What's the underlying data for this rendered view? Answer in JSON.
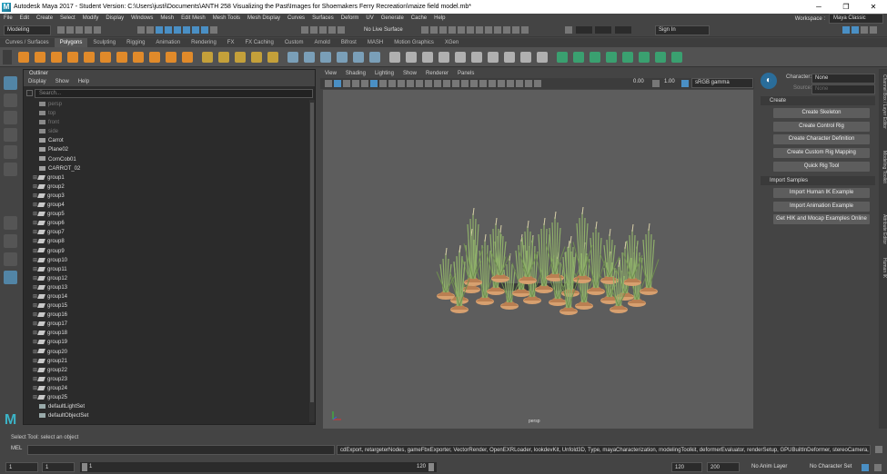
{
  "window": {
    "title": "Autodesk Maya 2017 - Student Version: C:\\Users\\justi\\Documents\\ANTH 258 Visualizing the Past\\Images for Shoemakers Ferry Recreation\\maize field model.mb*",
    "minimize": "─",
    "maximize": "❐",
    "close": "✕"
  },
  "menubar": [
    "File",
    "Edit",
    "Create",
    "Select",
    "Modify",
    "Display",
    "Windows",
    "Mesh",
    "Edit Mesh",
    "Mesh Tools",
    "Mesh Display",
    "Curves",
    "Surfaces",
    "Deform",
    "UV",
    "Generate",
    "Cache",
    "Help"
  ],
  "workspace": {
    "label": "Workspace :",
    "value": "Maya Classic"
  },
  "toolbar": {
    "mode": "Modeling",
    "live_surface": "No Live Surface",
    "sign_in": "Sign In"
  },
  "shelf_tabs": [
    "Curves / Surfaces",
    "Polygons",
    "Sculpting",
    "Rigging",
    "Animation",
    "Rendering",
    "FX",
    "FX Caching",
    "Custom",
    "Arnold",
    "Bifrost",
    "MASH",
    "Motion Graphics",
    "XGen"
  ],
  "active_shelf": "Polygons",
  "outliner": {
    "title": "Outliner",
    "menu": [
      "Display",
      "Show",
      "Help"
    ],
    "search_placeholder": "Search...",
    "items": [
      {
        "label": "persp",
        "kind": "camera",
        "dim": true
      },
      {
        "label": "top",
        "kind": "camera",
        "dim": true
      },
      {
        "label": "front",
        "kind": "camera",
        "dim": true
      },
      {
        "label": "side",
        "kind": "camera",
        "dim": true
      },
      {
        "label": "Carrot",
        "kind": "mesh",
        "dim": false
      },
      {
        "label": "Plane02",
        "kind": "mesh",
        "dim": false
      },
      {
        "label": "CornCob01",
        "kind": "mesh",
        "dim": false
      },
      {
        "label": "CARROT_02",
        "kind": "mesh",
        "dim": false
      },
      {
        "label": "group1",
        "kind": "group",
        "dim": false
      },
      {
        "label": "group2",
        "kind": "group",
        "dim": false
      },
      {
        "label": "group3",
        "kind": "group",
        "dim": false
      },
      {
        "label": "group4",
        "kind": "group",
        "dim": false
      },
      {
        "label": "group5",
        "kind": "group",
        "dim": false
      },
      {
        "label": "group6",
        "kind": "group",
        "dim": false
      },
      {
        "label": "group7",
        "kind": "group",
        "dim": false
      },
      {
        "label": "group8",
        "kind": "group",
        "dim": false
      },
      {
        "label": "group9",
        "kind": "group",
        "dim": false
      },
      {
        "label": "group10",
        "kind": "group",
        "dim": false
      },
      {
        "label": "group11",
        "kind": "group",
        "dim": false
      },
      {
        "label": "group12",
        "kind": "group",
        "dim": false
      },
      {
        "label": "group13",
        "kind": "group",
        "dim": false
      },
      {
        "label": "group14",
        "kind": "group",
        "dim": false
      },
      {
        "label": "group15",
        "kind": "group",
        "dim": false
      },
      {
        "label": "group16",
        "kind": "group",
        "dim": false
      },
      {
        "label": "group17",
        "kind": "group",
        "dim": false
      },
      {
        "label": "group18",
        "kind": "group",
        "dim": false
      },
      {
        "label": "group19",
        "kind": "group",
        "dim": false
      },
      {
        "label": "group20",
        "kind": "group",
        "dim": false
      },
      {
        "label": "group21",
        "kind": "group",
        "dim": false
      },
      {
        "label": "group22",
        "kind": "group",
        "dim": false
      },
      {
        "label": "group23",
        "kind": "group",
        "dim": false
      },
      {
        "label": "group24",
        "kind": "group",
        "dim": false
      },
      {
        "label": "group25",
        "kind": "group",
        "dim": false
      },
      {
        "label": "defaultLightSet",
        "kind": "set",
        "dim": false
      },
      {
        "label": "defaultObjectSet",
        "kind": "set",
        "dim": false
      }
    ]
  },
  "viewport": {
    "menu": [
      "View",
      "Shading",
      "Lighting",
      "Show",
      "Renderer",
      "Panels"
    ],
    "exposure": "0.00",
    "gamma": "1.00",
    "color_space": "sRGB gamma",
    "camera_label": "persp"
  },
  "hik": {
    "character_label": "Character:",
    "character_value": "None",
    "source_label": "Source:",
    "source_value": "None",
    "create_section": "Create",
    "create_buttons": [
      "Create Skeleton",
      "Create Control Rig",
      "Create Character Definition",
      "Create Custom Rig Mapping",
      "Quick Rig Tool"
    ],
    "import_section": "Import Samples",
    "import_buttons": [
      "Import Human IK Example",
      "Import Animation Example",
      "Get HIK and Mocap Examples Online"
    ]
  },
  "side_tabs": [
    "Channel Box / Layer Editor",
    "Modeling Toolkit",
    "Attribute Editor",
    "Human IK"
  ],
  "helpline": "Select Tool: select an object",
  "mel": {
    "label": "MEL",
    "output": "cdExport, retargeterNodes, gameFbxExporter, VectorRender, OpenEXRLoader, lookdevKit, Unfold3D, Type, mayaCharacterization, modelingToolkit, deformerEvaluator, renderSetup, GPUBuiltInDeformer, stereoCamera, fbxmaya"
  },
  "timeline": {
    "start": "1",
    "current": "1",
    "range_start_field": "1",
    "range_end_label": "120",
    "end": "120",
    "anim_end": "200",
    "anim_layer": "No Anim Layer",
    "character_set": "No Character Set"
  },
  "colors": {
    "accent": "#5285a6",
    "panel": "#444444",
    "viewport": "#5d5d5d",
    "plant_green": "#8fb06a",
    "mound": "#d7a06f"
  }
}
